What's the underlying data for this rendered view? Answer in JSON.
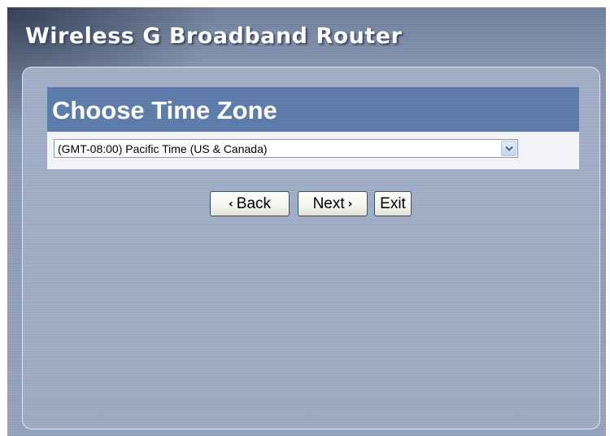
{
  "app": {
    "title": "Wireless G Broadband Router"
  },
  "wizard": {
    "step_title": "Choose Time Zone",
    "timezone": {
      "selected": "(GMT-08:00) Pacific Time (US & Canada)"
    },
    "buttons": {
      "back_chevron": "‹",
      "back_label": "Back",
      "next_label": "Next",
      "next_chevron": "›",
      "exit_label": "Exit"
    }
  },
  "colors": {
    "header_bar": "#5b7baa",
    "panel_background": "#9caac3",
    "window_background": "#8d9cb8",
    "select_row_background": "#f1f3f7"
  },
  "icons": {
    "dropdown": "chevron-down-icon",
    "back": "chevron-left-icon",
    "next": "chevron-right-icon"
  }
}
